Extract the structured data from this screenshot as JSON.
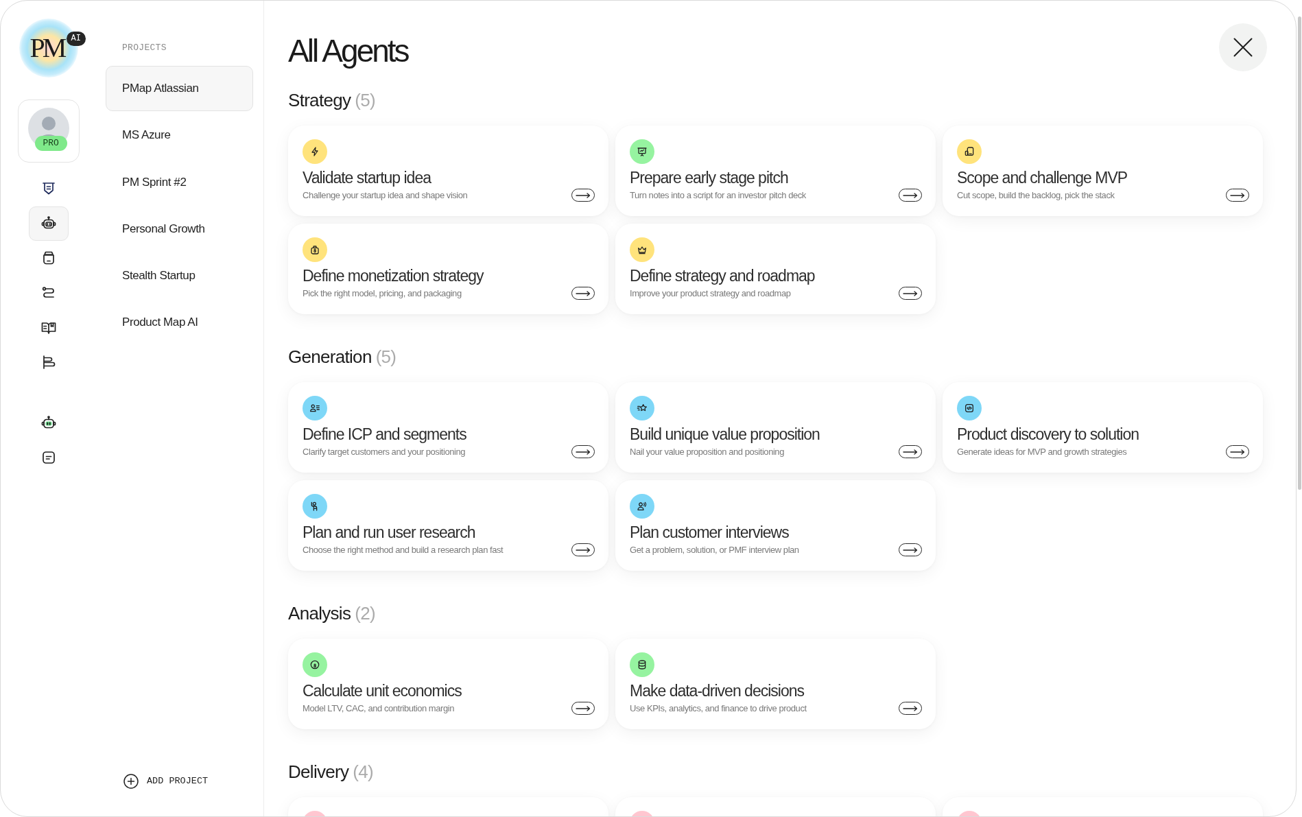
{
  "logo": {
    "text": "PM",
    "badge": "AI"
  },
  "profile": {
    "badge": "PRO"
  },
  "rail": {
    "items": [
      {
        "selected": false
      },
      {
        "selected": true
      },
      {
        "selected": false
      },
      {
        "selected": false
      },
      {
        "selected": false
      },
      {
        "selected": false
      }
    ],
    "bottom_items": [
      {
        "selected": false
      },
      {
        "selected": false
      }
    ]
  },
  "projects": {
    "heading": "PROJECTS",
    "items": [
      {
        "label": "PMap Atlassian",
        "selected": true
      },
      {
        "label": "MS Azure",
        "selected": false
      },
      {
        "label": "PM Sprint #2",
        "selected": false
      },
      {
        "label": "Personal Growth",
        "selected": false
      },
      {
        "label": "Stealth Startup",
        "selected": false
      },
      {
        "label": "Product Map AI",
        "selected": false
      }
    ],
    "add_button": "ADD PROJECT"
  },
  "main": {
    "title": "All Agents",
    "sections": [
      {
        "title": "Strategy",
        "count": "(5)",
        "cards": [
          {
            "title": "Validate startup idea",
            "description": "Challenge your startup idea and shape vision",
            "color": "#ffe37c"
          },
          {
            "title": "Prepare early stage pitch",
            "description": "Turn notes into a script for an investor pitch deck",
            "color": "#96f3a0"
          },
          {
            "title": "Scope and challenge MVP",
            "description": "Cut scope, build the backlog, pick the stack",
            "color": "#ffe37c"
          },
          {
            "title": "Define monetization strategy",
            "description": "Pick the right model, pricing, and packaging",
            "color": "#ffe37c"
          },
          {
            "title": "Define strategy and roadmap",
            "description": "Improve your product strategy and roadmap",
            "color": "#ffe37c"
          }
        ]
      },
      {
        "title": "Generation",
        "count": "(5)",
        "cards": [
          {
            "title": "Define ICP and segments",
            "description": "Clarify target customers and your positioning",
            "color": "#7ed7f7"
          },
          {
            "title": "Build unique value proposition",
            "description": "Nail your value proposition and positioning",
            "color": "#7ed7f7"
          },
          {
            "title": "Product discovery to solution",
            "description": "Generate ideas for MVP and growth strategies",
            "color": "#7ed7f7"
          },
          {
            "title": "Plan and run user research",
            "description": "Choose the right method and build a research plan fast",
            "color": "#7ed7f7"
          },
          {
            "title": "Plan customer interviews",
            "description": "Get a problem, solution, or PMF interview plan",
            "color": "#7ed7f7"
          }
        ]
      },
      {
        "title": "Analysis",
        "count": "(2)",
        "cards": [
          {
            "title": "Calculate unit economics",
            "description": "Model LTV, CAC, and contribution margin",
            "color": "#96f3a0"
          },
          {
            "title": "Make data-driven decisions",
            "description": "Use KPIs, analytics, and finance to drive product",
            "color": "#96f3a0"
          }
        ]
      },
      {
        "title": "Delivery",
        "count": "(4)",
        "cards": [
          {
            "color": "#ffc6d0"
          },
          {
            "color": "#ffc6d0"
          },
          {
            "color": "#ffc6d0"
          }
        ]
      }
    ]
  }
}
